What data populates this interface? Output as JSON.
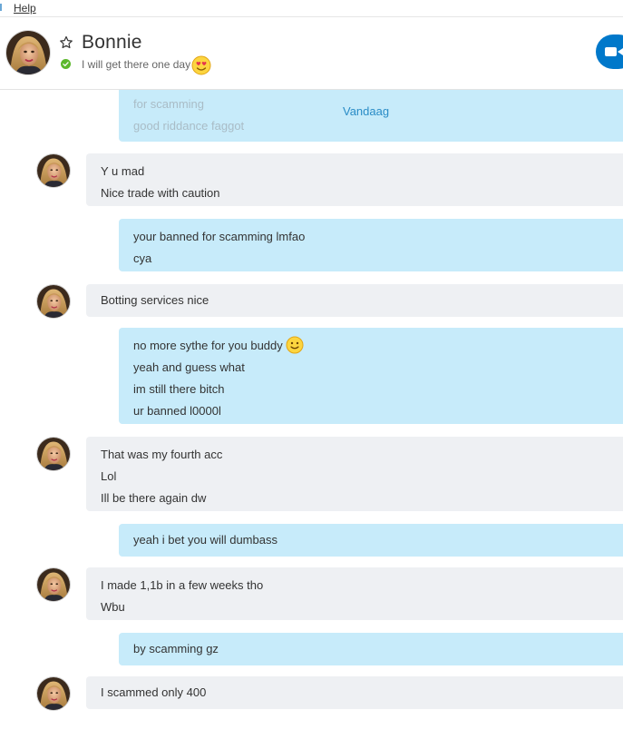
{
  "menu": {
    "help_label": "Help"
  },
  "contact": {
    "name": "Bonnie",
    "mood": "I will get there one day",
    "status_color": "#5cb82c"
  },
  "colors": {
    "accent": "#0078ca",
    "outgoing_bubble": "#c7ebfa",
    "incoming_bubble": "#eef0f3",
    "link": "#2a8cc6"
  },
  "conversation": {
    "previous_partial": [
      "for scamming",
      "good riddance faggot"
    ],
    "date_separator": "Vandaag",
    "messages": [
      {
        "direction": "incoming",
        "lines": [
          "Y u mad",
          "Nice trade with caution"
        ]
      },
      {
        "direction": "outgoing",
        "lines": [
          "your banned for scamming lmfao",
          "cya"
        ]
      },
      {
        "direction": "incoming",
        "lines": [
          "Botting services nice"
        ]
      },
      {
        "direction": "outgoing",
        "lines": [
          "no more sythe for you buddy",
          "yeah and guess what",
          "im still there bitch",
          "ur banned l0000l"
        ],
        "emoji": "smile-emoji"
      },
      {
        "direction": "incoming",
        "lines": [
          "That was my fourth acc",
          "Lol",
          "Ill be there again dw"
        ]
      },
      {
        "direction": "outgoing",
        "lines": [
          "yeah i bet you will dumbass"
        ]
      },
      {
        "direction": "incoming",
        "lines": [
          "I made 1,1b in a few weeks tho",
          "Wbu"
        ]
      },
      {
        "direction": "outgoing",
        "lines": [
          "by scamming gz"
        ]
      },
      {
        "direction": "incoming",
        "lines": [
          "I scammed only 400"
        ]
      }
    ]
  },
  "icons": {
    "star": "star-outline-icon",
    "presence": "online-check-icon",
    "mood_emoji": "in-love-emoji",
    "call": "video-call-icon"
  }
}
